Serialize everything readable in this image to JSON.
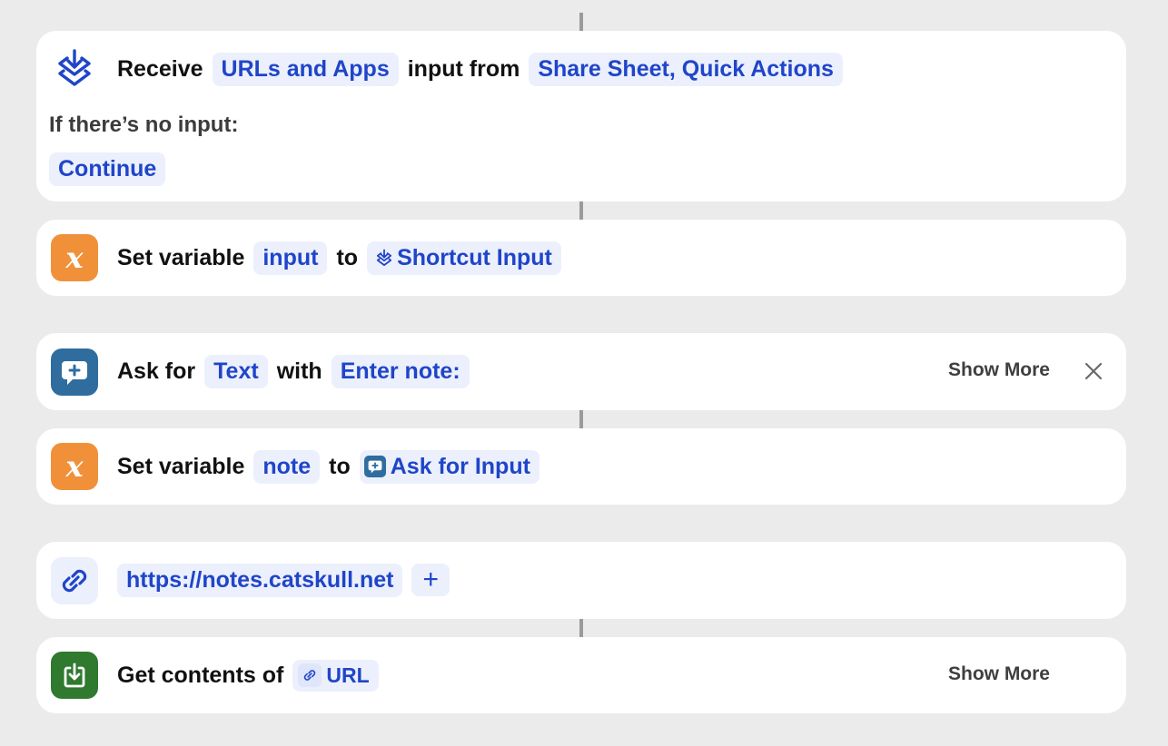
{
  "colors": {
    "accent": "#1f45c9",
    "token_bg": "#ecf0fc",
    "variable_orange": "#f0913a",
    "ask_blue": "#2f6d9f",
    "get_green": "#2f7a2e",
    "background": "#ebebeb"
  },
  "actions": [
    {
      "type": "receive",
      "icon": "shortcut-input-icon",
      "word_receive": "Receive",
      "token_types": "URLs and Apps",
      "word_input_from": "input from",
      "token_sources": "Share Sheet, Quick Actions",
      "no_input_label": "If there’s no input:",
      "no_input_value": "Continue"
    },
    {
      "type": "set-variable",
      "icon": "variable-x-icon",
      "word_set_variable": "Set variable",
      "token_name": "input",
      "word_to": "to",
      "token_value": "Shortcut Input",
      "token_value_icon": "shortcut-input-icon"
    },
    {
      "type": "ask-for-input",
      "icon": "speech-bubble-plus-icon",
      "word_ask_for": "Ask for",
      "token_type": "Text",
      "word_with": "with",
      "token_prompt": "Enter note:",
      "show_more": "Show More",
      "close_icon": "close-icon"
    },
    {
      "type": "set-variable",
      "icon": "variable-x-icon",
      "word_set_variable": "Set variable",
      "token_name": "note",
      "word_to": "to",
      "token_value": "Ask for Input",
      "token_value_icon": "speech-bubble-plus-icon"
    },
    {
      "type": "url",
      "icon": "link-icon",
      "token_url": "https://notes.catskull.net",
      "add_label": "+"
    },
    {
      "type": "get-contents",
      "icon": "download-tray-icon",
      "word_get_contents_of": "Get contents of",
      "token_value": "URL",
      "token_value_icon": "link-icon",
      "show_more": "Show More"
    }
  ]
}
